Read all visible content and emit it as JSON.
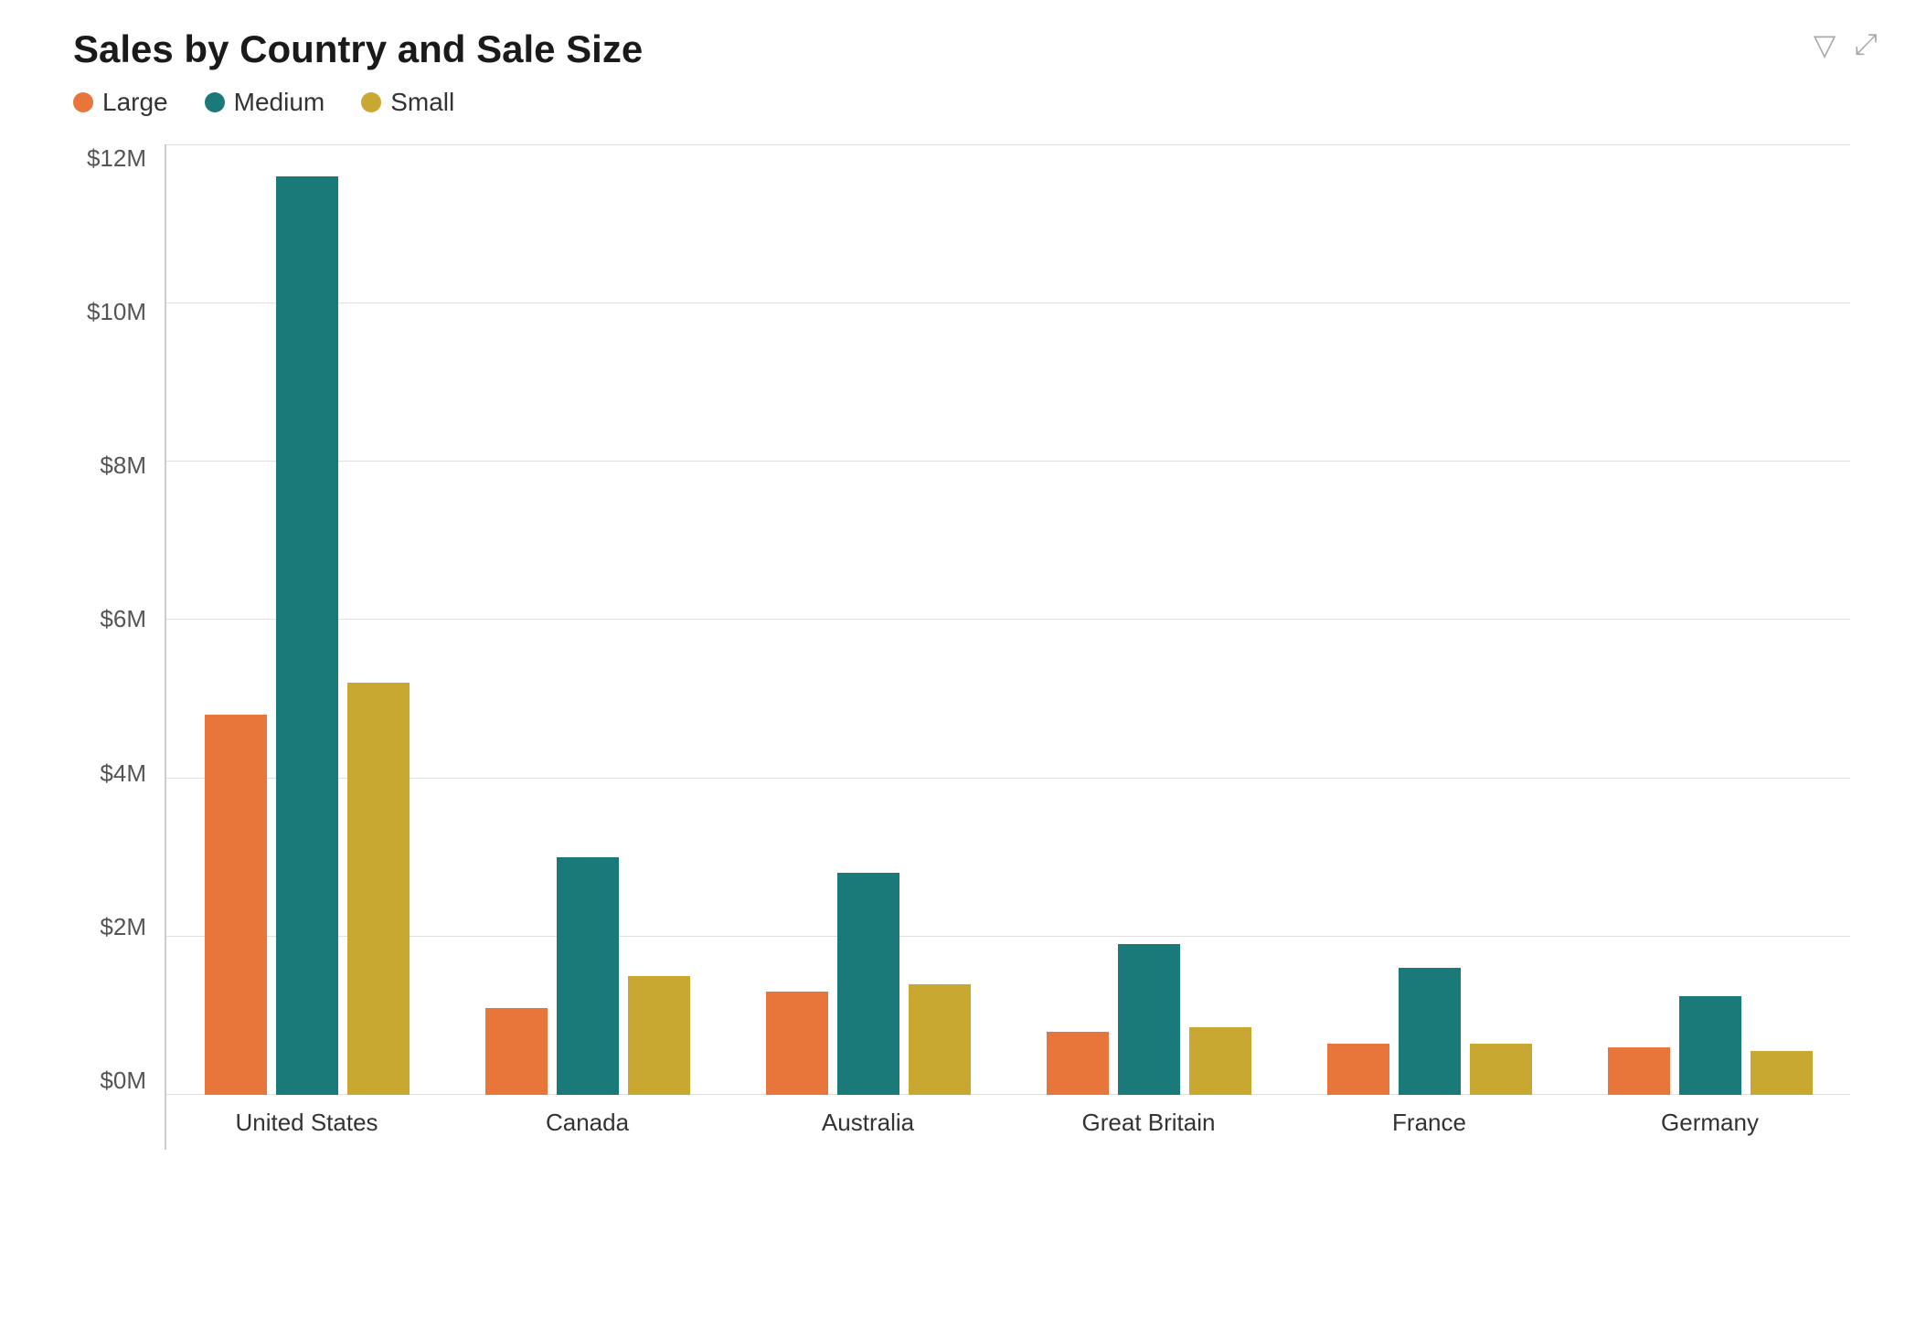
{
  "title": "Sales by Country and Sale Size",
  "legend": {
    "items": [
      {
        "label": "Large",
        "color": "#E8763A"
      },
      {
        "label": "Medium",
        "color": "#1A7A7A"
      },
      {
        "label": "Small",
        "color": "#C8A830"
      }
    ]
  },
  "yAxis": {
    "ticks": [
      "$0M",
      "$2M",
      "$4M",
      "$6M",
      "$8M",
      "$10M",
      "$12M"
    ]
  },
  "maxValue": 12,
  "countries": [
    {
      "name": "United States",
      "bars": [
        {
          "type": "Large",
          "value": 4.8,
          "color": "#E8763A"
        },
        {
          "type": "Medium",
          "value": 11.6,
          "color": "#1A7A7A"
        },
        {
          "type": "Small",
          "value": 5.2,
          "color": "#C8A830"
        }
      ]
    },
    {
      "name": "Canada",
      "bars": [
        {
          "type": "Large",
          "value": 1.1,
          "color": "#E8763A"
        },
        {
          "type": "Medium",
          "value": 3.0,
          "color": "#1A7A7A"
        },
        {
          "type": "Small",
          "value": 1.5,
          "color": "#C8A830"
        }
      ]
    },
    {
      "name": "Australia",
      "bars": [
        {
          "type": "Large",
          "value": 1.3,
          "color": "#E8763A"
        },
        {
          "type": "Medium",
          "value": 2.8,
          "color": "#1A7A7A"
        },
        {
          "type": "Small",
          "value": 1.4,
          "color": "#C8A830"
        }
      ]
    },
    {
      "name": "Great Britain",
      "bars": [
        {
          "type": "Large",
          "value": 0.8,
          "color": "#E8763A"
        },
        {
          "type": "Medium",
          "value": 1.9,
          "color": "#1A7A7A"
        },
        {
          "type": "Small",
          "value": 0.85,
          "color": "#C8A830"
        }
      ]
    },
    {
      "name": "France",
      "bars": [
        {
          "type": "Large",
          "value": 0.65,
          "color": "#E8763A"
        },
        {
          "type": "Medium",
          "value": 1.6,
          "color": "#1A7A7A"
        },
        {
          "type": "Small",
          "value": 0.65,
          "color": "#C8A830"
        }
      ]
    },
    {
      "name": "Germany",
      "bars": [
        {
          "type": "Large",
          "value": 0.6,
          "color": "#E8763A"
        },
        {
          "type": "Medium",
          "value": 1.25,
          "color": "#1A7A7A"
        },
        {
          "type": "Small",
          "value": 0.55,
          "color": "#C8A830"
        }
      ]
    }
  ],
  "icons": {
    "filter": "⊿",
    "expand": "⤢"
  }
}
